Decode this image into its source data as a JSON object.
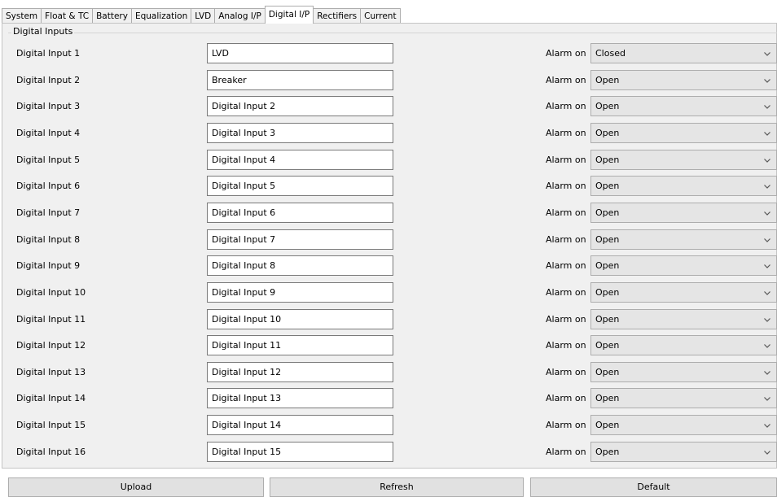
{
  "tabs": [
    {
      "label": "System"
    },
    {
      "label": "Float & TC"
    },
    {
      "label": "Battery"
    },
    {
      "label": "Equalization"
    },
    {
      "label": "LVD"
    },
    {
      "label": "Analog I/P"
    },
    {
      "label": "Digital I/P"
    },
    {
      "label": "Rectifiers"
    },
    {
      "label": "Current"
    }
  ],
  "active_tab": "Digital I/P",
  "group": {
    "title": "Digital Inputs"
  },
  "alarm_label": "Alarm on",
  "inputs": [
    {
      "label": "Digital Input 1",
      "name": "LVD",
      "alarm": "Closed"
    },
    {
      "label": "Digital Input 2",
      "name": "Breaker",
      "alarm": "Open"
    },
    {
      "label": "Digital Input 3",
      "name": "Digital Input 2",
      "alarm": "Open"
    },
    {
      "label": "Digital Input 4",
      "name": "Digital Input 3",
      "alarm": "Open"
    },
    {
      "label": "Digital Input 5",
      "name": "Digital Input 4",
      "alarm": "Open"
    },
    {
      "label": "Digital Input 6",
      "name": "Digital Input 5",
      "alarm": "Open"
    },
    {
      "label": "Digital Input 7",
      "name": "Digital Input 6",
      "alarm": "Open"
    },
    {
      "label": "Digital Input 8",
      "name": "Digital Input 7",
      "alarm": "Open"
    },
    {
      "label": "Digital Input 9",
      "name": "Digital Input 8",
      "alarm": "Open"
    },
    {
      "label": "Digital Input 10",
      "name": "Digital Input 9",
      "alarm": "Open"
    },
    {
      "label": "Digital Input 11",
      "name": "Digital Input 10",
      "alarm": "Open"
    },
    {
      "label": "Digital Input 12",
      "name": "Digital Input 11",
      "alarm": "Open"
    },
    {
      "label": "Digital Input 13",
      "name": "Digital Input 12",
      "alarm": "Open"
    },
    {
      "label": "Digital Input 14",
      "name": "Digital Input 13",
      "alarm": "Open"
    },
    {
      "label": "Digital Input 15",
      "name": "Digital Input 14",
      "alarm": "Open"
    },
    {
      "label": "Digital Input 16",
      "name": "Digital Input 15",
      "alarm": "Open"
    }
  ],
  "buttons": {
    "upload": "Upload",
    "refresh": "Refresh",
    "default": "Default"
  },
  "icons": {
    "dropdown": "chevron-down-icon"
  },
  "colors": {
    "pane_bg": "#f0f0f0",
    "input_bg": "#ffffff",
    "select_bg": "#e5e5e5",
    "button_bg": "#e1e1e1",
    "border": "#adadad"
  }
}
